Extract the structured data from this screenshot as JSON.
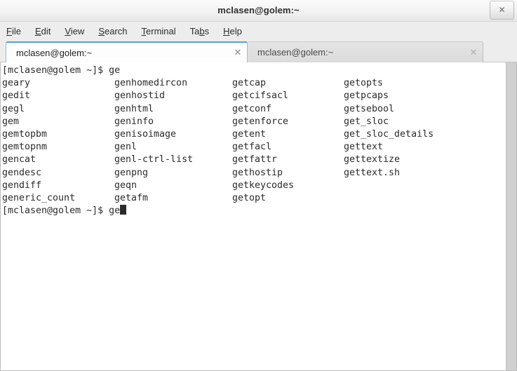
{
  "window": {
    "title": "mclasen@golem:~",
    "close_label": "✕"
  },
  "menubar": {
    "items": [
      {
        "label": "File",
        "pre": "",
        "acc": "F",
        "post": "ile"
      },
      {
        "label": "Edit",
        "pre": "",
        "acc": "E",
        "post": "dit"
      },
      {
        "label": "View",
        "pre": "",
        "acc": "V",
        "post": "iew"
      },
      {
        "label": "Search",
        "pre": "",
        "acc": "S",
        "post": "earch"
      },
      {
        "label": "Terminal",
        "pre": "",
        "acc": "T",
        "post": "erminal"
      },
      {
        "label": "Tabs",
        "pre": "Ta",
        "acc": "b",
        "post": "s"
      },
      {
        "label": "Help",
        "pre": "",
        "acc": "H",
        "post": "elp"
      }
    ]
  },
  "tabs": [
    {
      "label": "mclasen@golem:~",
      "close": "✕",
      "active": true
    },
    {
      "label": "mclasen@golem:~",
      "close": "✕",
      "active": false
    }
  ],
  "terminal": {
    "prompt": "[mclasen@golem ~]$ ",
    "first_command": "ge",
    "current_input": "ge",
    "cursor_visible": true,
    "columns": [
      [
        "geary",
        "gedit",
        "gegl",
        "gem",
        "gemtopbm",
        "gemtopnm",
        "gencat",
        "gendesc",
        "gendiff",
        "generic_count"
      ],
      [
        "genhomedircon",
        "genhostid",
        "genhtml",
        "geninfo",
        "genisoimage",
        "genl",
        "genl-ctrl-list",
        "genpng",
        "geqn",
        "getafm"
      ],
      [
        "getcap",
        "getcifsacl",
        "getconf",
        "getenforce",
        "getent",
        "getfacl",
        "getfattr",
        "gethostip",
        "getkeycodes",
        "getopt"
      ],
      [
        "getopts",
        "getpcaps",
        "getsebool",
        "get_sloc",
        "get_sloc_details",
        "gettext",
        "gettextize",
        "gettext.sh"
      ]
    ],
    "colors": {
      "background": "#ffffff",
      "foreground": "#2b2b2b",
      "cursor": "#2b2b2b"
    }
  },
  "chrome_colors": {
    "titlebar_top": "#fbfbfb",
    "titlebar_bottom": "#e8e8e8",
    "menubar": "#ededed",
    "active_tab_accent": "#5b9dd9",
    "inactive_tab": "#dfdfdf",
    "scrollbar_track": "#d0d0d0"
  }
}
